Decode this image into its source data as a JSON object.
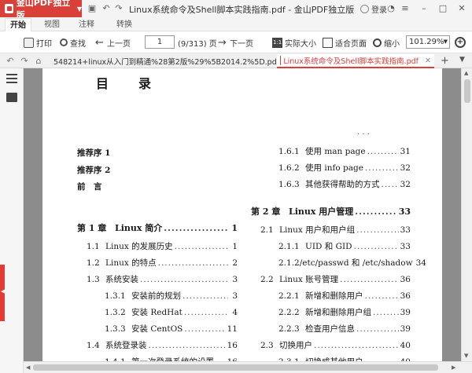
{
  "app": {
    "name": "金山PDF独立版",
    "window_title": "Linux系统命令及Shell脚本实践指南.pdf - 金山PDF独立版",
    "login_label": "登录"
  },
  "menu_tabs": [
    "开始",
    "视图",
    "注释",
    "转换"
  ],
  "toolbar": {
    "print_label": "打印",
    "find_label": "查找",
    "prev_label": "上一页",
    "page_value": "1",
    "page_total": "(9/313) 页",
    "next_label": "下一页",
    "actual_size_label": "实际大小",
    "fit_page_label": "适合页面",
    "zoom_out_label": "缩小",
    "zoom_value": "101.29%"
  },
  "doc_tabs": [
    {
      "label": "548214+linux从入门到精通%28第2版%29%5B2014.2%5D.pdf",
      "active": false
    },
    {
      "label": "Linux系统命令及Shell脚本实践指南.pdf",
      "active": true
    }
  ],
  "toc": {
    "title": "目录",
    "mark": ". . .",
    "left": [
      {
        "num": "",
        "label": "推荐序 1",
        "page": "",
        "kind": "pre"
      },
      {
        "num": "",
        "label": "推荐序 2",
        "page": "",
        "kind": "pre"
      },
      {
        "num": "",
        "label": "前　言",
        "page": "",
        "kind": "pre"
      },
      {
        "num": "第 1 章",
        "label": "Linux 简介",
        "page": "1",
        "kind": "ch"
      },
      {
        "num": "1.1",
        "label": "Linux 的发展历史",
        "page": "1",
        "kind": "sec"
      },
      {
        "num": "1.2",
        "label": "Linux 的特点",
        "page": "2",
        "kind": "sec"
      },
      {
        "num": "1.3",
        "label": "系统安装",
        "page": "3",
        "kind": "sec"
      },
      {
        "num": "1.3.1",
        "label": "安装前的规划",
        "page": "3",
        "kind": "sub"
      },
      {
        "num": "1.3.2",
        "label": "安装 RedHat",
        "page": "4",
        "kind": "sub"
      },
      {
        "num": "1.3.3",
        "label": "安装 CentOS",
        "page": "11",
        "kind": "sub"
      },
      {
        "num": "1.4",
        "label": "系统登录装",
        "page": "16",
        "kind": "sec"
      },
      {
        "num": "1.4.1",
        "label": "第一次登录系统的设置",
        "page": "16",
        "kind": "sub"
      }
    ],
    "right": [
      {
        "num": "1.6.1",
        "label": "使用 man page",
        "page": "31",
        "kind": "sub"
      },
      {
        "num": "1.6.2",
        "label": "使用 info page",
        "page": "32",
        "kind": "sub"
      },
      {
        "num": "1.6.3",
        "label": "其他获得帮助的方式",
        "page": "32",
        "kind": "sub"
      },
      {
        "num": "第 2 章",
        "label": "Linux 用户管理",
        "page": "33",
        "kind": "ch"
      },
      {
        "num": "2.1",
        "label": "Linux 用户和用户组",
        "page": "33",
        "kind": "sec"
      },
      {
        "num": "2.1.1",
        "label": "UID 和 GID",
        "page": "33",
        "kind": "sub"
      },
      {
        "num": "2.1.2",
        "label": "/etc/passwd 和 /etc/shadow",
        "page": "34",
        "kind": "sub"
      },
      {
        "num": "2.2",
        "label": "Linux 账号管理",
        "page": "36",
        "kind": "sec"
      },
      {
        "num": "2.2.1",
        "label": "新增和删除用户",
        "page": "36",
        "kind": "sub"
      },
      {
        "num": "2.2.2",
        "label": "新增和删除用户组",
        "page": "39",
        "kind": "sub"
      },
      {
        "num": "2.2.3",
        "label": "检查用户信息",
        "page": "39",
        "kind": "sub"
      },
      {
        "num": "2.3",
        "label": "切换用户",
        "page": "40",
        "kind": "sec"
      },
      {
        "num": "2.3.1",
        "label": "切换成其他用户",
        "page": "40",
        "kind": "sub"
      }
    ]
  }
}
